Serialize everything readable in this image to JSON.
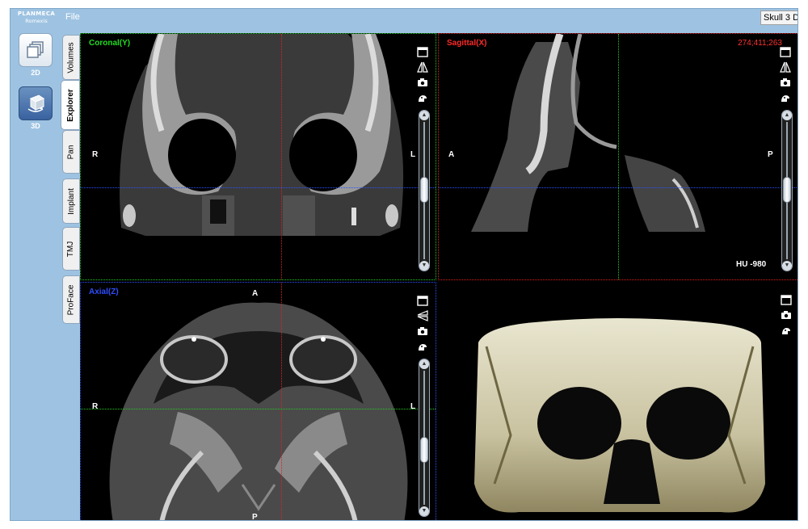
{
  "app": {
    "logo_line1": "PLANMECA",
    "logo_line2": "Romexis",
    "file_menu": "File",
    "document_title": "Skull 3 D"
  },
  "mode_buttons": [
    {
      "label": "2D",
      "icon": "stacked-layers-icon"
    },
    {
      "label": "3D",
      "icon": "rotate-cube-icon"
    }
  ],
  "tabs": [
    "Volumes",
    "Explorer",
    "Pan",
    "Implant",
    "TMJ",
    "ProFace"
  ],
  "active_tab": "Explorer",
  "views": {
    "coronal": {
      "title": "Coronal(Y)",
      "color": "#22dd22",
      "left": "R",
      "right": "L"
    },
    "sagittal": {
      "title": "Sagittal(X)",
      "color": "#ff2a2a",
      "left": "A",
      "right": "P",
      "coordinates": "274;411;263",
      "hu_readout": "HU -980"
    },
    "axial": {
      "title": "Axial(Z)",
      "color": "#2f4dff",
      "top": "A",
      "bottom": "P",
      "left": "R",
      "right": "L"
    },
    "render3d": {
      "title": ""
    }
  },
  "toolbar_icons": [
    "maximize-icon",
    "flip-icon",
    "camera-icon",
    "measure-hand-icon"
  ],
  "colors": {
    "crosshair_green": "#22cc22",
    "crosshair_red": "#e02020",
    "crosshair_blue": "#3050ff",
    "app_background": "#9ec3e2"
  }
}
